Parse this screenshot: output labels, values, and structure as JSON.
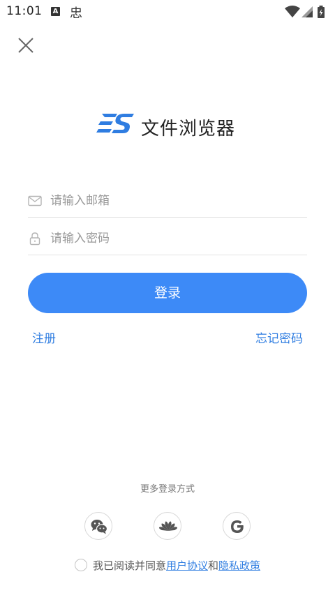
{
  "status_bar": {
    "time": "11:01",
    "notification_a": "A",
    "notification_app": "忠"
  },
  "logo": {
    "app_name": "文件浏览器"
  },
  "form": {
    "email_placeholder": "请输入邮箱",
    "password_placeholder": "请输入密码",
    "login_label": "登录"
  },
  "links": {
    "register": "注册",
    "forgot_password": "忘记密码"
  },
  "more_login": {
    "title": "更多登录方式"
  },
  "agreement": {
    "prefix": "我已阅读并同意",
    "user_agreement": "用户协议",
    "and": "和",
    "privacy_policy": "隐私政策"
  },
  "colors": {
    "accent": "#3d8af7",
    "link": "#2f7de1"
  }
}
